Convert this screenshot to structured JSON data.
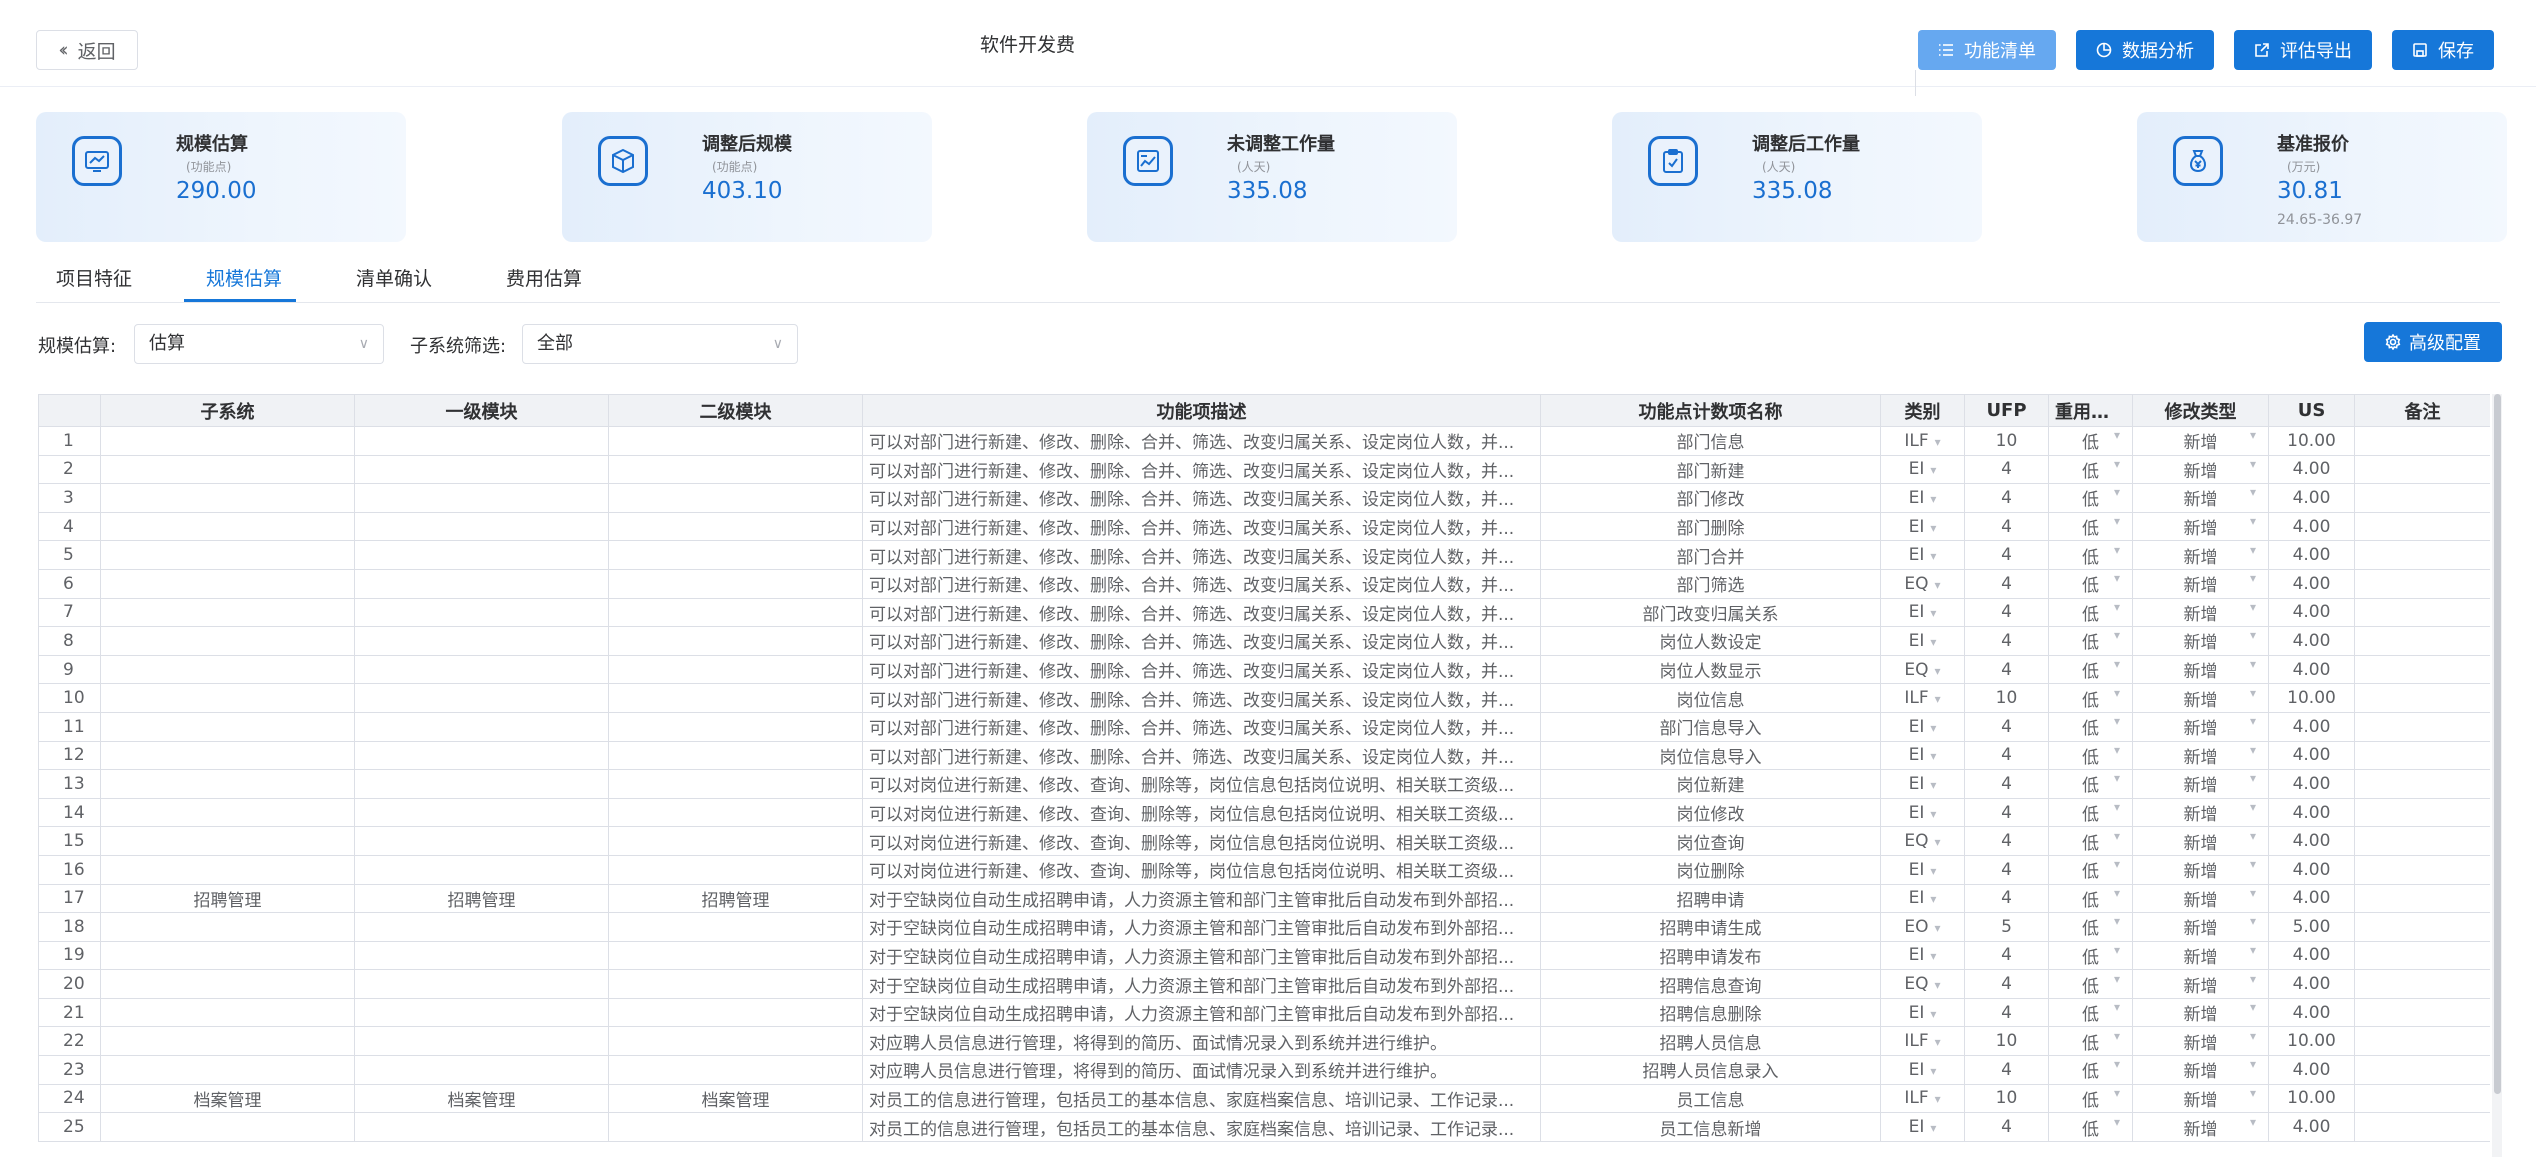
{
  "header": {
    "back_label": "返回",
    "title": "软件开发费",
    "buttons": {
      "function_list": "功能清单",
      "data_analysis": "数据分析",
      "export": "评估导出",
      "save": "保存"
    }
  },
  "cards": [
    {
      "title": "规模估算",
      "unit": "(功能点)",
      "value": "290.00",
      "range": ""
    },
    {
      "title": "调整后规模",
      "unit": "(功能点)",
      "value": "403.10",
      "range": ""
    },
    {
      "title": "未调整工作量",
      "unit": "(人天)",
      "value": "335.08",
      "range": ""
    },
    {
      "title": "调整后工作量",
      "unit": "(人天)",
      "value": "335.08",
      "range": ""
    },
    {
      "title": "基准报价",
      "unit": "(万元)",
      "value": "30.81",
      "range": "24.65-36.97"
    }
  ],
  "tabs": [
    "项目特征",
    "规模估算",
    "清单确认",
    "费用估算"
  ],
  "active_tab": "规模估算",
  "filters": {
    "scale_label": "规模估算:",
    "scale_value": "估算",
    "subsystem_label": "子系统筛选:",
    "subsystem_value": "全部",
    "advanced_button": "高级配置"
  },
  "table": {
    "columns": [
      "",
      "子系统",
      "一级模块",
      "二级模块",
      "功能项描述",
      "功能点计数项名称",
      "类别",
      "UFP",
      "重用程度",
      "修改类型",
      "US",
      "备注"
    ],
    "rows": [
      [
        "1",
        "",
        "",
        "",
        "可以对部门进行新建、修改、删除、合并、筛选、改变归属关系、设定岗位人数，并...",
        "部门信息",
        "ILF",
        "10",
        "低",
        "新增",
        "10.00",
        ""
      ],
      [
        "2",
        "",
        "",
        "",
        "可以对部门进行新建、修改、删除、合并、筛选、改变归属关系、设定岗位人数，并...",
        "部门新建",
        "EI",
        "4",
        "低",
        "新增",
        "4.00",
        ""
      ],
      [
        "3",
        "",
        "",
        "",
        "可以对部门进行新建、修改、删除、合并、筛选、改变归属关系、设定岗位人数，并...",
        "部门修改",
        "EI",
        "4",
        "低",
        "新增",
        "4.00",
        ""
      ],
      [
        "4",
        "",
        "",
        "",
        "可以对部门进行新建、修改、删除、合并、筛选、改变归属关系、设定岗位人数，并...",
        "部门删除",
        "EI",
        "4",
        "低",
        "新增",
        "4.00",
        ""
      ],
      [
        "5",
        "",
        "",
        "",
        "可以对部门进行新建、修改、删除、合并、筛选、改变归属关系、设定岗位人数，并...",
        "部门合并",
        "EI",
        "4",
        "低",
        "新增",
        "4.00",
        ""
      ],
      [
        "6",
        "",
        "",
        "",
        "可以对部门进行新建、修改、删除、合并、筛选、改变归属关系、设定岗位人数，并...",
        "部门筛选",
        "EQ",
        "4",
        "低",
        "新增",
        "4.00",
        ""
      ],
      [
        "7",
        "",
        "",
        "",
        "可以对部门进行新建、修改、删除、合并、筛选、改变归属关系、设定岗位人数，并...",
        "部门改变归属关系",
        "EI",
        "4",
        "低",
        "新增",
        "4.00",
        ""
      ],
      [
        "8",
        "",
        "",
        "",
        "可以对部门进行新建、修改、删除、合并、筛选、改变归属关系、设定岗位人数，并...",
        "岗位人数设定",
        "EI",
        "4",
        "低",
        "新增",
        "4.00",
        ""
      ],
      [
        "9",
        "",
        "",
        "",
        "可以对部门进行新建、修改、删除、合并、筛选、改变归属关系、设定岗位人数，并...",
        "岗位人数显示",
        "EQ",
        "4",
        "低",
        "新增",
        "4.00",
        ""
      ],
      [
        "10",
        "",
        "",
        "",
        "可以对部门进行新建、修改、删除、合并、筛选、改变归属关系、设定岗位人数，并...",
        "岗位信息",
        "ILF",
        "10",
        "低",
        "新增",
        "10.00",
        ""
      ],
      [
        "11",
        "",
        "",
        "",
        "可以对部门进行新建、修改、删除、合并、筛选、改变归属关系、设定岗位人数，并...",
        "部门信息导入",
        "EI",
        "4",
        "低",
        "新增",
        "4.00",
        ""
      ],
      [
        "12",
        "",
        "",
        "",
        "可以对部门进行新建、修改、删除、合并、筛选、改变归属关系、设定岗位人数，并...",
        "岗位信息导入",
        "EI",
        "4",
        "低",
        "新增",
        "4.00",
        ""
      ],
      [
        "13",
        "",
        "",
        "",
        "可以对岗位进行新建、修改、查询、删除等，岗位信息包括岗位说明、相关联工资级...",
        "岗位新建",
        "EI",
        "4",
        "低",
        "新增",
        "4.00",
        ""
      ],
      [
        "14",
        "",
        "",
        "",
        "可以对岗位进行新建、修改、查询、删除等，岗位信息包括岗位说明、相关联工资级...",
        "岗位修改",
        "EI",
        "4",
        "低",
        "新增",
        "4.00",
        ""
      ],
      [
        "15",
        "",
        "",
        "",
        "可以对岗位进行新建、修改、查询、删除等，岗位信息包括岗位说明、相关联工资级...",
        "岗位查询",
        "EQ",
        "4",
        "低",
        "新增",
        "4.00",
        ""
      ],
      [
        "16",
        "",
        "",
        "",
        "可以对岗位进行新建、修改、查询、删除等，岗位信息包括岗位说明、相关联工资级...",
        "岗位删除",
        "EI",
        "4",
        "低",
        "新增",
        "4.00",
        ""
      ],
      [
        "17",
        "招聘管理",
        "招聘管理",
        "招聘管理",
        "对于空缺岗位自动生成招聘申请，人力资源主管和部门主管审批后自动发布到外部招...",
        "招聘申请",
        "EI",
        "4",
        "低",
        "新增",
        "4.00",
        ""
      ],
      [
        "18",
        "",
        "",
        "",
        "对于空缺岗位自动生成招聘申请，人力资源主管和部门主管审批后自动发布到外部招...",
        "招聘申请生成",
        "EO",
        "5",
        "低",
        "新增",
        "5.00",
        ""
      ],
      [
        "19",
        "",
        "",
        "",
        "对于空缺岗位自动生成招聘申请，人力资源主管和部门主管审批后自动发布到外部招...",
        "招聘申请发布",
        "EI",
        "4",
        "低",
        "新增",
        "4.00",
        ""
      ],
      [
        "20",
        "",
        "",
        "",
        "对于空缺岗位自动生成招聘申请，人力资源主管和部门主管审批后自动发布到外部招...",
        "招聘信息查询",
        "EQ",
        "4",
        "低",
        "新增",
        "4.00",
        ""
      ],
      [
        "21",
        "",
        "",
        "",
        "对于空缺岗位自动生成招聘申请，人力资源主管和部门主管审批后自动发布到外部招...",
        "招聘信息删除",
        "EI",
        "4",
        "低",
        "新增",
        "4.00",
        ""
      ],
      [
        "22",
        "",
        "",
        "",
        "对应聘人员信息进行管理，将得到的简历、面试情况录入到系统并进行维护。",
        "招聘人员信息",
        "ILF",
        "10",
        "低",
        "新增",
        "10.00",
        ""
      ],
      [
        "23",
        "",
        "",
        "",
        "对应聘人员信息进行管理，将得到的简历、面试情况录入到系统并进行维护。",
        "招聘人员信息录入",
        "EI",
        "4",
        "低",
        "新增",
        "4.00",
        ""
      ],
      [
        "24",
        "档案管理",
        "档案管理",
        "档案管理",
        "对员工的信息进行管理，包括员工的基本信息、家庭档案信息、培训记录、工作记录...",
        "员工信息",
        "ILF",
        "10",
        "低",
        "新增",
        "10.00",
        ""
      ],
      [
        "25",
        "",
        "",
        "",
        "对员工的信息进行管理，包括员工的基本信息、家庭档案信息、培训记录、工作记录...",
        "员工信息新增",
        "EI",
        "4",
        "低",
        "新增",
        "4.00",
        ""
      ]
    ]
  }
}
